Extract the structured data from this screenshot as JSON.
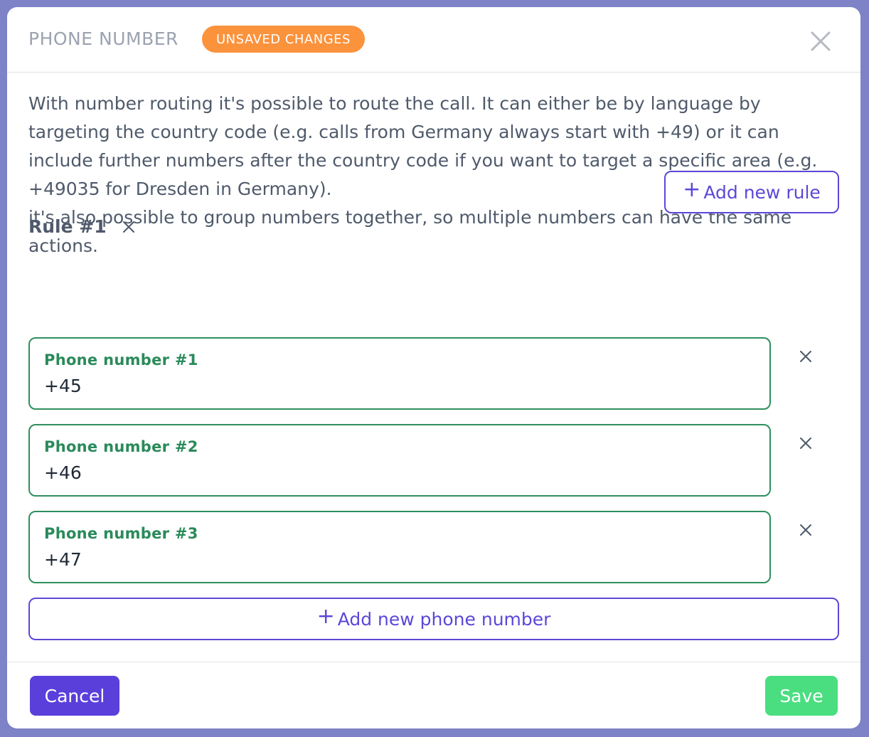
{
  "modal": {
    "title": "PHONE NUMBER",
    "badge": "UNSAVED CHANGES",
    "close_icon": "close-icon"
  },
  "description": {
    "paragraph1": "With number routing it's possible to route the call. It can either be by language by targeting the country code (e.g. calls from Germany always start with +49) or it can include further numbers after the country code if you want to target a specific area (e.g. +49035 for Dresden in Germany).",
    "paragraph2": "it's also possible to group numbers together, so multiple numbers can have the same actions."
  },
  "add_rule": {
    "plus": "+",
    "label": "Add new rule"
  },
  "rule": {
    "title": "Rule #1",
    "phones": [
      {
        "label": "Phone number #1",
        "value": "+45"
      },
      {
        "label": "Phone number #2",
        "value": "+46"
      },
      {
        "label": "Phone number #3",
        "value": "+47"
      }
    ]
  },
  "add_phone": {
    "plus": "+",
    "label": "Add new phone number"
  },
  "footer": {
    "cancel_label": "Cancel",
    "save_label": "Save"
  },
  "colors": {
    "accent": "#5b48d8",
    "badge": "#fb923c",
    "field_border": "#2f8f5f",
    "save": "#4ade80",
    "cancel": "#5b3fdb"
  }
}
